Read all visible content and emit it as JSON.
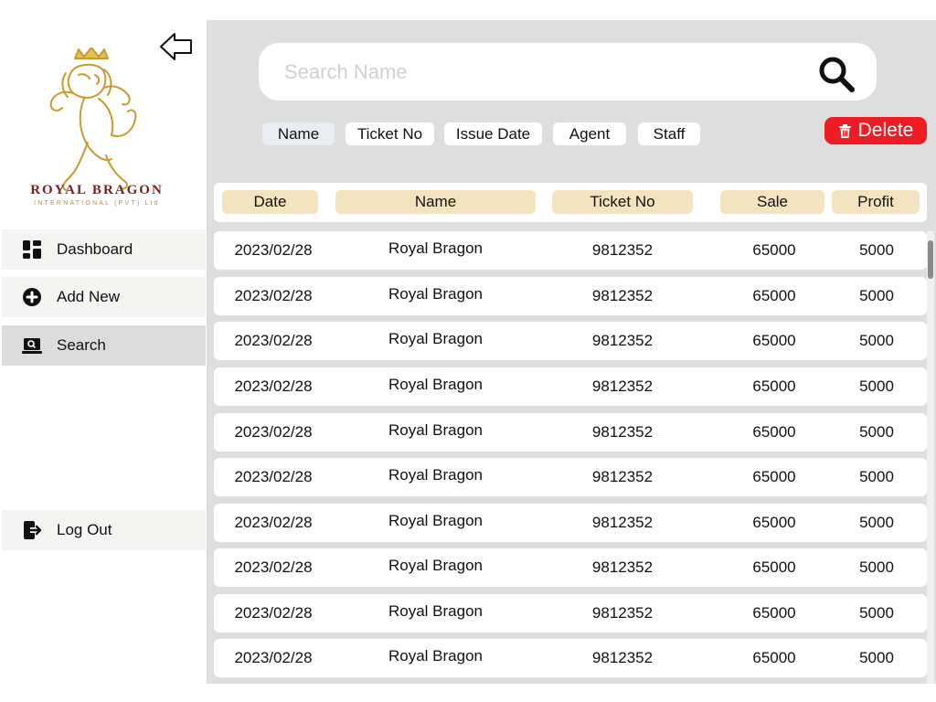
{
  "brand": {
    "name": "ROYAL BRAGON",
    "subtitle": "INTERNATIONAL (PVT) Ltd"
  },
  "sidebar": {
    "items": [
      {
        "label": "Dashboard",
        "icon": "dashboard-grid-icon"
      },
      {
        "label": "Add New",
        "icon": "plus-circle-icon"
      },
      {
        "label": "Search",
        "icon": "search-laptop-icon",
        "active": true
      },
      {
        "label": "Log Out",
        "icon": "logout-icon"
      }
    ]
  },
  "search": {
    "placeholder": "Search Name",
    "value": ""
  },
  "filters": [
    {
      "label": "Name",
      "active": true
    },
    {
      "label": "Ticket No",
      "active": false
    },
    {
      "label": "Issue Date",
      "active": false
    },
    {
      "label": "Agent",
      "active": false
    },
    {
      "label": "Staff",
      "active": false
    }
  ],
  "delete_label": "Delete",
  "table": {
    "columns": [
      "Date",
      "Name",
      "Ticket No",
      "Sale",
      "Profit"
    ],
    "rows": [
      [
        "2023/02/28",
        "Royal Bragon",
        "9812352",
        "65000",
        "5000"
      ],
      [
        "2023/02/28",
        "Royal Bragon",
        "9812352",
        "65000",
        "5000"
      ],
      [
        "2023/02/28",
        "Royal Bragon",
        "9812352",
        "65000",
        "5000"
      ],
      [
        "2023/02/28",
        "Royal Bragon",
        "9812352",
        "65000",
        "5000"
      ],
      [
        "2023/02/28",
        "Royal Bragon",
        "9812352",
        "65000",
        "5000"
      ],
      [
        "2023/02/28",
        "Royal Bragon",
        "9812352",
        "65000",
        "5000"
      ],
      [
        "2023/02/28",
        "Royal Bragon",
        "9812352",
        "65000",
        "5000"
      ],
      [
        "2023/02/28",
        "Royal Bragon",
        "9812352",
        "65000",
        "5000"
      ],
      [
        "2023/02/28",
        "Royal Bragon",
        "9812352",
        "65000",
        "5000"
      ],
      [
        "2023/02/28",
        "Royal Bragon",
        "9812352",
        "65000",
        "5000"
      ]
    ]
  },
  "colors": {
    "main_bg": "#dedede",
    "header_chip": "#f3e4bf",
    "delete": "#ee1c24",
    "brand_red": "#7a1f1f",
    "brand_gold": "#b8903a"
  }
}
